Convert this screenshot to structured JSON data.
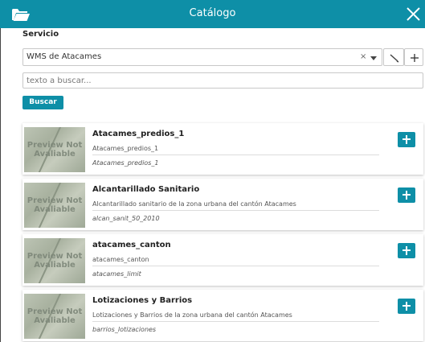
{
  "header": {
    "title": "Catálogo",
    "folder_icon": "folder-open-icon",
    "close_icon": "close-icon"
  },
  "service": {
    "label": "Servicio",
    "selected": "WMS de Atacames",
    "clear_glyph": "×",
    "caret_icon": "chevron-down-icon",
    "edit_icon": "pencil-icon",
    "add_icon": "plus-icon"
  },
  "search": {
    "placeholder": "texto a buscar...",
    "button_label": "Buscar"
  },
  "preview_text": "Preview Not Avaliable",
  "records": [
    {
      "title": "Atacames_predios_1",
      "description": "Atacames_predios_1",
      "identifier": "Atacames_predios_1"
    },
    {
      "title": "Alcantarillado Sanitario",
      "description": "Alcantarillado sanitario de la zona urbana del cantón Atacames",
      "identifier": "alcan_sanit_50_2010"
    },
    {
      "title": "atacames_canton",
      "description": "atacames_canton",
      "identifier": "atacames_limit"
    },
    {
      "title": "Lotizaciones y Barrios",
      "description": "Lotizaciones y Barrios de la zona urbana del cantón Atacames",
      "identifier": "barrios_lotizaciones"
    }
  ],
  "colors": {
    "accent": "#0e8fa7",
    "background": "#ffffff"
  }
}
